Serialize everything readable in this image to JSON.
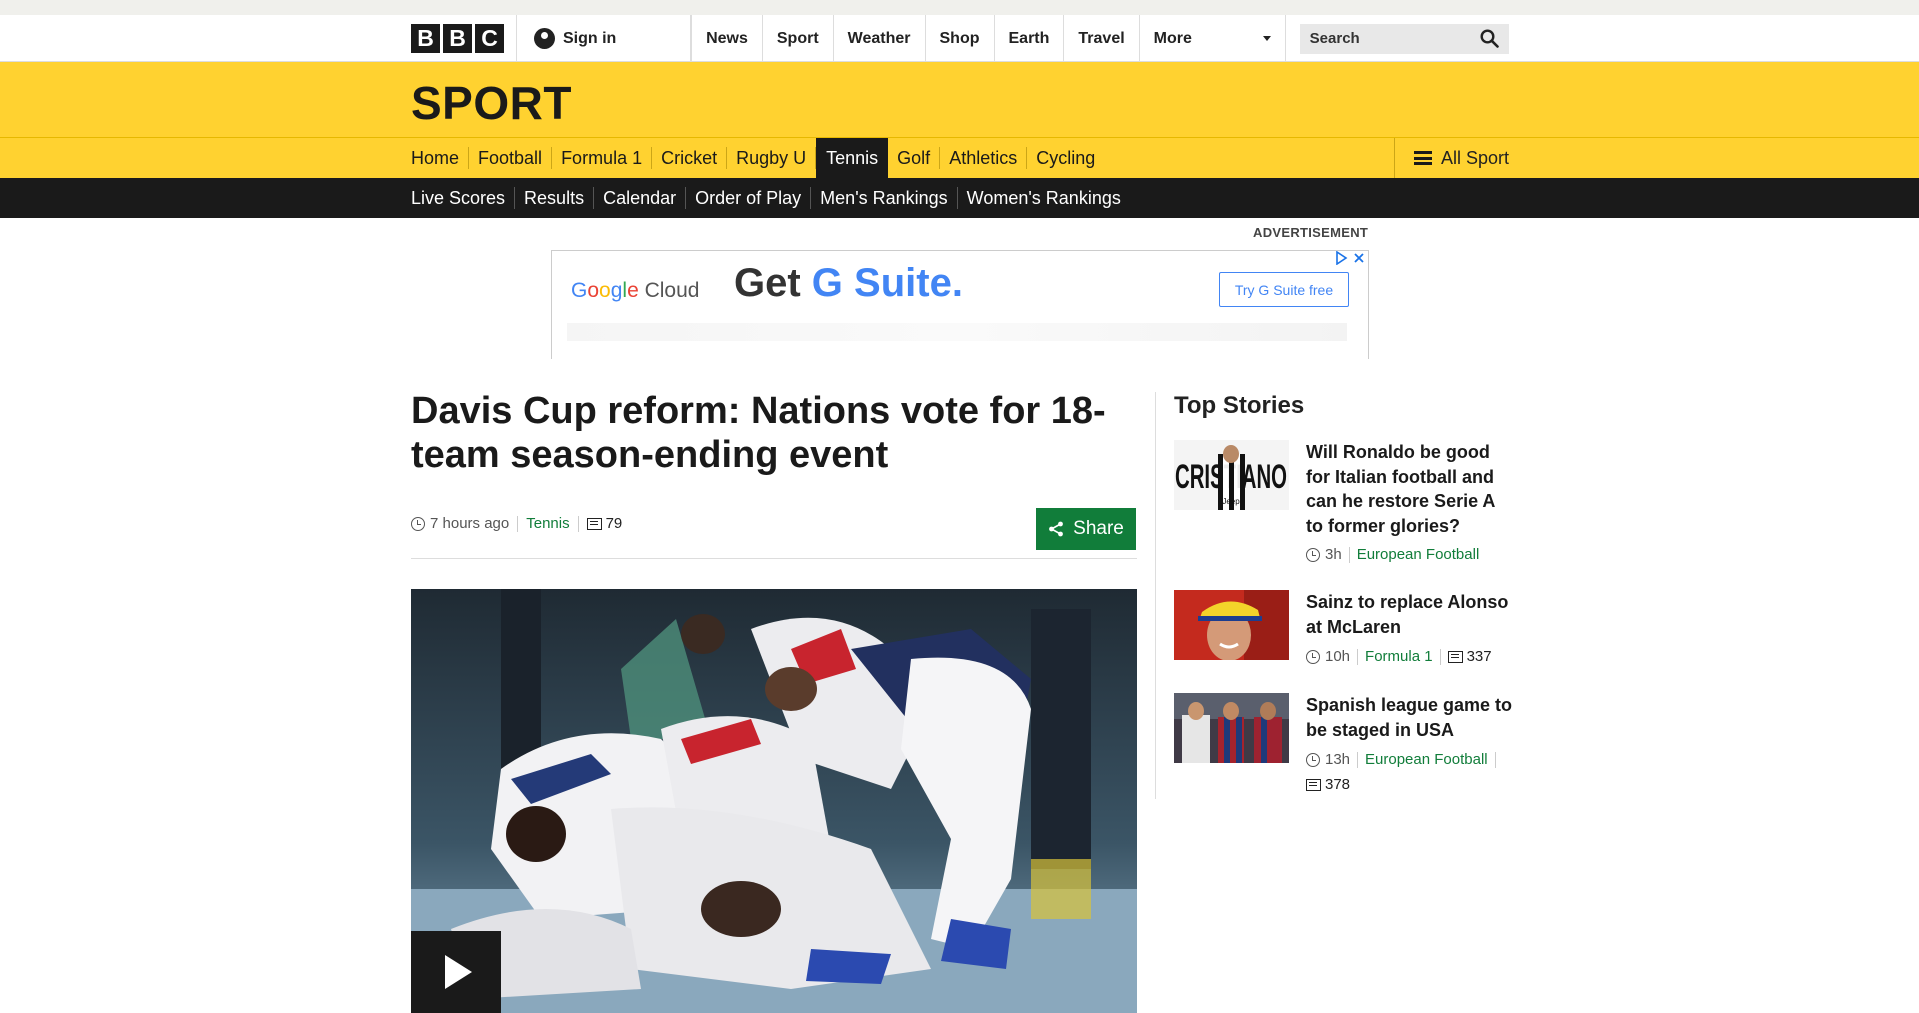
{
  "global": {
    "logo": [
      "B",
      "B",
      "C"
    ],
    "signin": "Sign in",
    "nav": [
      "News",
      "Sport",
      "Weather",
      "Shop",
      "Earth",
      "Travel"
    ],
    "more": "More",
    "search_label": "Search"
  },
  "sport": {
    "title": "SPORT",
    "nav": [
      "Home",
      "Football",
      "Formula 1",
      "Cricket",
      "Rugby U",
      "Tennis",
      "Golf",
      "Athletics",
      "Cycling"
    ],
    "active": "Tennis",
    "all_sport": "All Sport",
    "subnav": [
      "Live Scores",
      "Results",
      "Calendar",
      "Order of Play",
      "Men's Rankings",
      "Women's Rankings"
    ]
  },
  "ad": {
    "label": "ADVERTISEMENT",
    "brand_google": "Google",
    "brand_cloud": "Cloud",
    "headline_a": "Get ",
    "headline_b": "G Suite.",
    "cta": "Try G Suite free"
  },
  "article": {
    "headline": "Davis Cup reform: Nations vote for 18-team season-ending event",
    "time": "7 hours ago",
    "topic": "Tennis",
    "comments": "79",
    "share": "Share"
  },
  "top_stories": {
    "title": "Top Stories",
    "items": [
      {
        "title": "Will Ronaldo be good for Italian football and can he restore Serie A to former glories?",
        "time": "3h",
        "topic": "European Football",
        "comments": ""
      },
      {
        "title": "Sainz to replace Alonso at McLaren",
        "time": "10h",
        "topic": "Formula 1",
        "comments": "337"
      },
      {
        "title": "Spanish league game to be staged in USA",
        "time": "13h",
        "topic": "European Football",
        "comments": "378"
      }
    ],
    "thumb1_text": "CRISTIANO",
    "thumb1_jersey": "Jeep"
  },
  "colors": {
    "sport_yellow": "#ffd230",
    "topic_green": "#117d3a",
    "subnav_black": "#1a1a1a",
    "google_blue": "#4285f4"
  }
}
